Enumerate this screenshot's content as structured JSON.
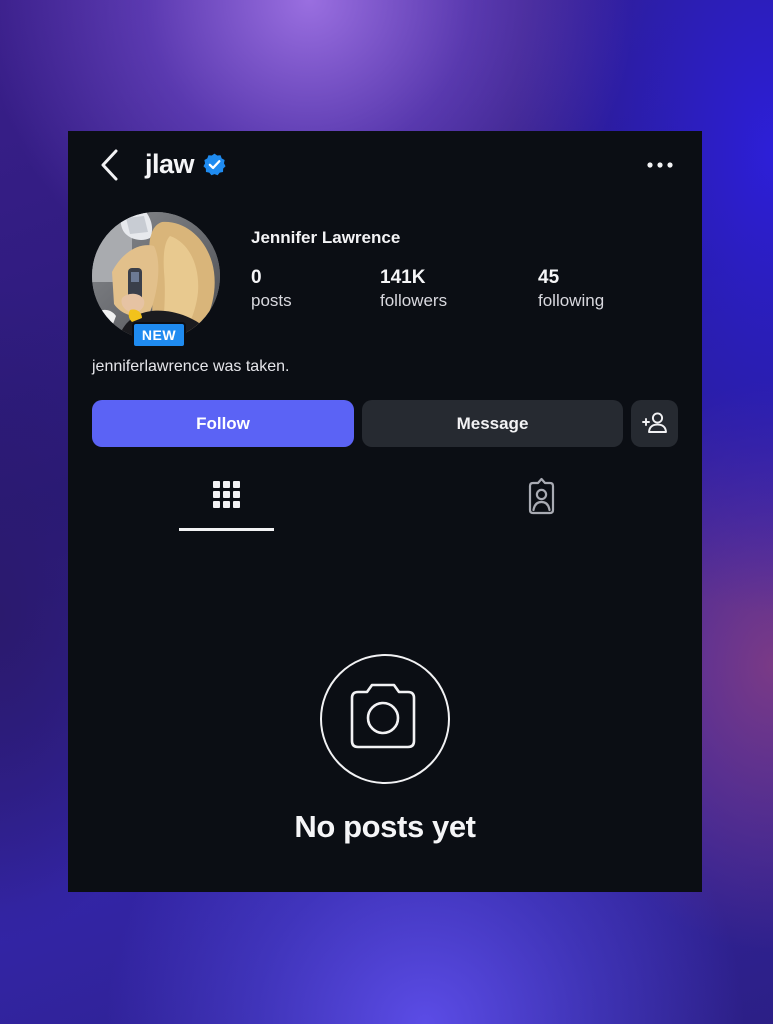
{
  "header": {
    "username": "jlaw",
    "verified": true,
    "icons": {
      "back": "chevron-left-icon",
      "verified": "verified-badge-icon",
      "more": "more-horizontal-icon"
    }
  },
  "profile": {
    "display_name": "Jennifer Lawrence",
    "avatar_badge": "NEW",
    "bio": "jenniferlawrence was taken.",
    "stats": {
      "posts": {
        "value": "0",
        "label": "posts"
      },
      "followers": {
        "value": "141K",
        "label": "followers"
      },
      "following": {
        "value": "45",
        "label": "following"
      }
    }
  },
  "actions": {
    "follow_label": "Follow",
    "message_label": "Message",
    "add_user_icon": "add-user-icon"
  },
  "tabs": [
    {
      "name": "grid",
      "icon": "grid-icon",
      "active": true
    },
    {
      "name": "tagged",
      "icon": "tagged-person-icon",
      "active": false
    }
  ],
  "empty_state": {
    "icon": "camera-icon",
    "text": "No posts yet"
  },
  "colors": {
    "card_background": "#0b0e14",
    "follow_button": "#5b63f5",
    "secondary_button": "#262a31",
    "verified_badge": "#1f8bf0"
  }
}
